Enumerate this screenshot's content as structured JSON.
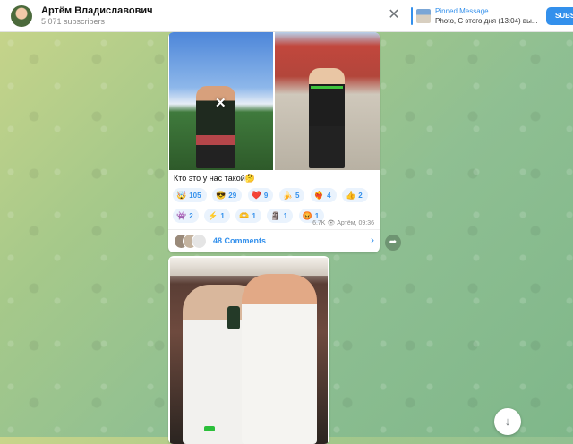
{
  "header": {
    "channel_name": "Артём Владиславович",
    "subscribers": "5 071 subscribers",
    "close_symbol": "✕",
    "pinned": {
      "title": "Pinned Message",
      "text": "Photo, С этого дня (13:04) вы..."
    },
    "subscribe_label": "SUBS"
  },
  "message1": {
    "caption": "Кто это у нас такой🤔",
    "reactions": [
      {
        "emoji": "🤯",
        "count": "105"
      },
      {
        "emoji": "😎",
        "count": "29"
      },
      {
        "emoji": "❤️",
        "count": "9"
      },
      {
        "emoji": "🍌",
        "count": "5"
      },
      {
        "emoji": "❤️‍🔥",
        "count": "4"
      },
      {
        "emoji": "👍",
        "count": "2"
      },
      {
        "emoji": "👾",
        "count": "2"
      },
      {
        "emoji": "⚡",
        "count": "1"
      },
      {
        "emoji": "🫶",
        "count": "1"
      },
      {
        "emoji": "🗿",
        "count": "1"
      },
      {
        "emoji": "😡",
        "count": "1"
      }
    ],
    "views": "6.7K 👁",
    "author_time": "Артём, 09:36",
    "comments_label": "48 Comments",
    "comments_arrow": "›"
  },
  "share_symbol": "➦",
  "scroll_down_symbol": "↓",
  "colors": {
    "accent": "#3390ec",
    "reaction_bg": "#eaf3fd"
  }
}
